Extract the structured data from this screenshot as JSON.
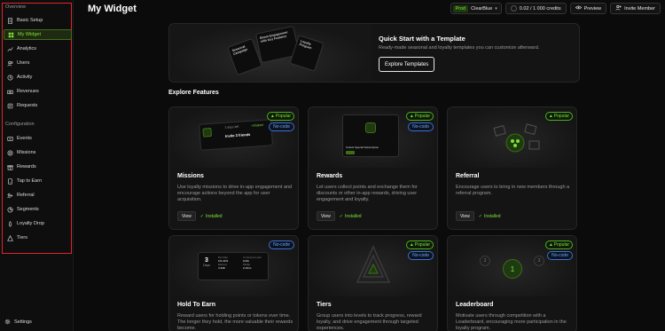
{
  "sidebar": {
    "overview_label": "Overview",
    "configuration_label": "Configuration",
    "overview_items": [
      {
        "label": "Basic Setup",
        "icon": "doc-icon"
      },
      {
        "label": "My Widget",
        "icon": "widget-icon",
        "active": true
      },
      {
        "label": "Analytics",
        "icon": "chart-icon"
      },
      {
        "label": "Users",
        "icon": "users-icon"
      },
      {
        "label": "Activity",
        "icon": "activity-icon"
      },
      {
        "label": "Revenues",
        "icon": "revenue-icon"
      },
      {
        "label": "Requests",
        "icon": "requests-icon"
      }
    ],
    "config_items": [
      {
        "label": "Events",
        "icon": "events-icon"
      },
      {
        "label": "Missions",
        "icon": "missions-icon"
      },
      {
        "label": "Rewards",
        "icon": "rewards-icon"
      },
      {
        "label": "Tap to Earn",
        "icon": "tap-icon"
      },
      {
        "label": "Referral",
        "icon": "referral-icon"
      },
      {
        "label": "Segments",
        "icon": "segments-icon"
      },
      {
        "label": "Loyalty Drop",
        "icon": "drop-icon"
      },
      {
        "label": "Tiers",
        "icon": "tiers-icon"
      }
    ],
    "settings_label": "Settings",
    "highlight_color": "#e0242b",
    "accent": "#7ee03a"
  },
  "header": {
    "title": "My Widget",
    "env_badge": "Prod",
    "project": "ClearBlue",
    "credits": "0.02 / 1 000 credits",
    "preview": "Preview",
    "invite": "Invite Member"
  },
  "banner": {
    "title": "Quick Start with a Template",
    "subtitle": "Ready-made seasonal and loyalty templates you can customize afterward.",
    "button": "Explore Templates",
    "card_texts": [
      "Seasonal Campaign",
      "Boost Engagement with Key Features",
      "Loyalty Program"
    ]
  },
  "explore": {
    "title": "Explore Features",
    "cards": [
      {
        "title": "Missions",
        "desc": "Use loyalty missions to drive in-app engagement and encourage actions beyond the app for user acquisition.",
        "popular": "Popular",
        "nocode": "No-code",
        "view": "View",
        "installed": "Installed",
        "preview": {
          "days": "3 days left",
          "shared": "+Shared",
          "mission": "Invite 3 friends"
        }
      },
      {
        "title": "Rewards",
        "desc": "Let users collect points and exchange them for discounts or other in-app rewards, driving user engagement and loyalty.",
        "popular": "Popular",
        "nocode": "No-code",
        "view": "View",
        "installed": "Installed",
        "preview": {
          "label": "Unlock Special Subscription"
        }
      },
      {
        "title": "Referral",
        "desc": "Encourage users to bring in new members through a referral program.",
        "popular": "Popular",
        "view": "View",
        "installed": "Installed"
      },
      {
        "title": "Hold To Earn",
        "desc": "Reward users for holding points or tokens over time. The longer they hold, the more valuable their rewards become.",
        "nocode": "No-code",
        "preview": {
          "num": "3",
          "unit": "Days",
          "rows": [
            [
              "Per Day",
              "1%.41%"
            ],
            [
              "Earned",
              "4 348"
            ],
            [
              "In Current Lock",
              "0.2%"
            ],
            [
              "Multip.",
              "2.1%m"
            ]
          ]
        }
      },
      {
        "title": "Tiers",
        "desc": "Group users into levels to track progress, reward loyalty, and drive engagement through targeted experiences.",
        "popular": "Popular",
        "nocode": "No-code"
      },
      {
        "title": "Leaderboard",
        "desc": "Motivate users through competition with a Leaderboard, encouraging more participation in the loyalty program.",
        "popular": "Popular",
        "nocode": "No-code",
        "preview": {
          "ranks": [
            "2",
            "1",
            "3"
          ]
        }
      }
    ]
  }
}
